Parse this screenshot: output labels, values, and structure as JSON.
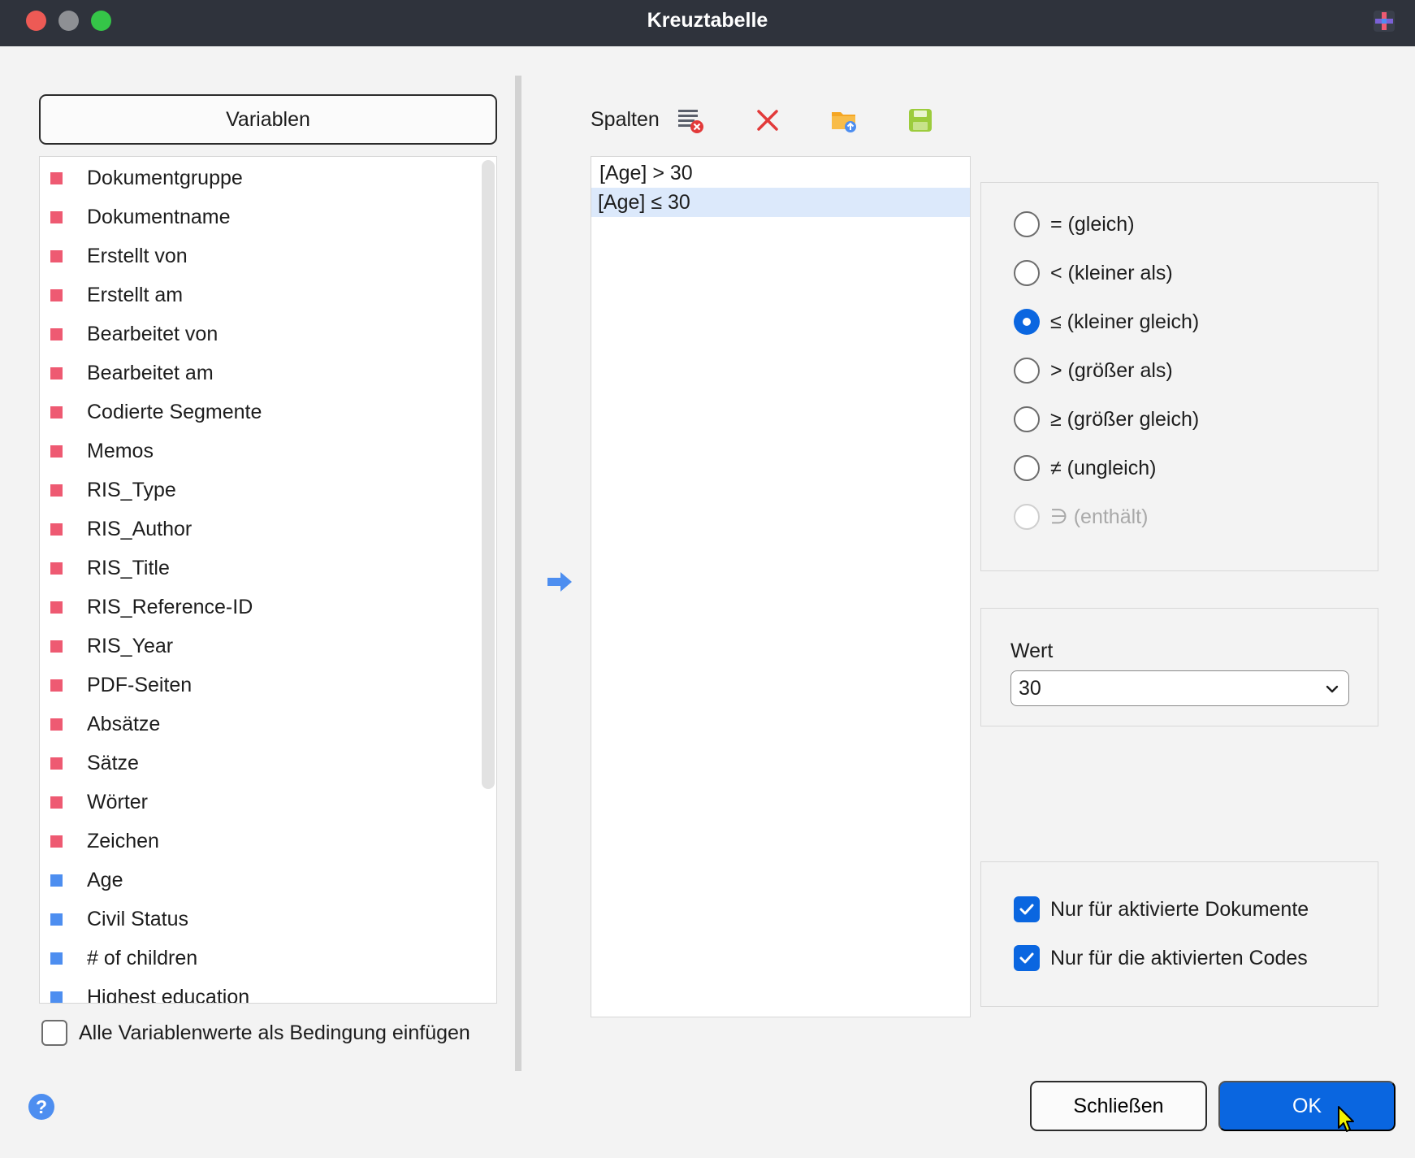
{
  "window": {
    "title": "Kreuztabelle"
  },
  "left": {
    "variables_button": "Variablen",
    "variables": [
      {
        "label": "Dokumentgruppe",
        "type": "system"
      },
      {
        "label": "Dokumentname",
        "type": "system"
      },
      {
        "label": "Erstellt von",
        "type": "system"
      },
      {
        "label": "Erstellt am",
        "type": "system"
      },
      {
        "label": "Bearbeitet von",
        "type": "system"
      },
      {
        "label": "Bearbeitet am",
        "type": "system"
      },
      {
        "label": "Codierte Segmente",
        "type": "system"
      },
      {
        "label": "Memos",
        "type": "system"
      },
      {
        "label": "RIS_Type",
        "type": "system"
      },
      {
        "label": "RIS_Author",
        "type": "system"
      },
      {
        "label": "RIS_Title",
        "type": "system"
      },
      {
        "label": "RIS_Reference-ID",
        "type": "system"
      },
      {
        "label": "RIS_Year",
        "type": "system"
      },
      {
        "label": "PDF-Seiten",
        "type": "system"
      },
      {
        "label": "Absätze",
        "type": "system"
      },
      {
        "label": "Sätze",
        "type": "system"
      },
      {
        "label": "Wörter",
        "type": "system"
      },
      {
        "label": "Zeichen",
        "type": "system"
      },
      {
        "label": "Age",
        "type": "user"
      },
      {
        "label": "Civil Status",
        "type": "user"
      },
      {
        "label": "# of children",
        "type": "user"
      },
      {
        "label": "Highest education",
        "type": "user"
      }
    ],
    "insert_all_values_label": "Alle Variablenwerte als Bedingung einfügen",
    "insert_all_values_checked": false
  },
  "columns": {
    "label": "Spalten",
    "conditions": [
      "[Age] > 30",
      "[Age] ≤ 30"
    ],
    "selected_index": 1
  },
  "operators": [
    {
      "label": "= (gleich)",
      "checked": false,
      "disabled": false
    },
    {
      "label": "< (kleiner als)",
      "checked": false,
      "disabled": false
    },
    {
      "label": "≤ (kleiner gleich)",
      "checked": true,
      "disabled": false
    },
    {
      "label": "> (größer als)",
      "checked": false,
      "disabled": false
    },
    {
      "label": "≥ (größer gleich)",
      "checked": false,
      "disabled": false
    },
    {
      "label": "≠ (ungleich)",
      "checked": false,
      "disabled": false
    },
    {
      "label": "∋ (enthält)",
      "checked": false,
      "disabled": true
    }
  ],
  "value": {
    "label": "Wert",
    "selected": "30"
  },
  "options": {
    "only_activated_documents": "Nur für aktivierte Dokumente",
    "only_activated_codes": "Nur für die aktivierten Codes"
  },
  "footer": {
    "close_label": "Schließen",
    "ok_label": "OK",
    "help_glyph": "?"
  },
  "colors": {
    "system_variable": "#ee5a72",
    "user_variable": "#4d8ef0",
    "accent": "#0a66e0",
    "titlebar": "#2f333c"
  }
}
